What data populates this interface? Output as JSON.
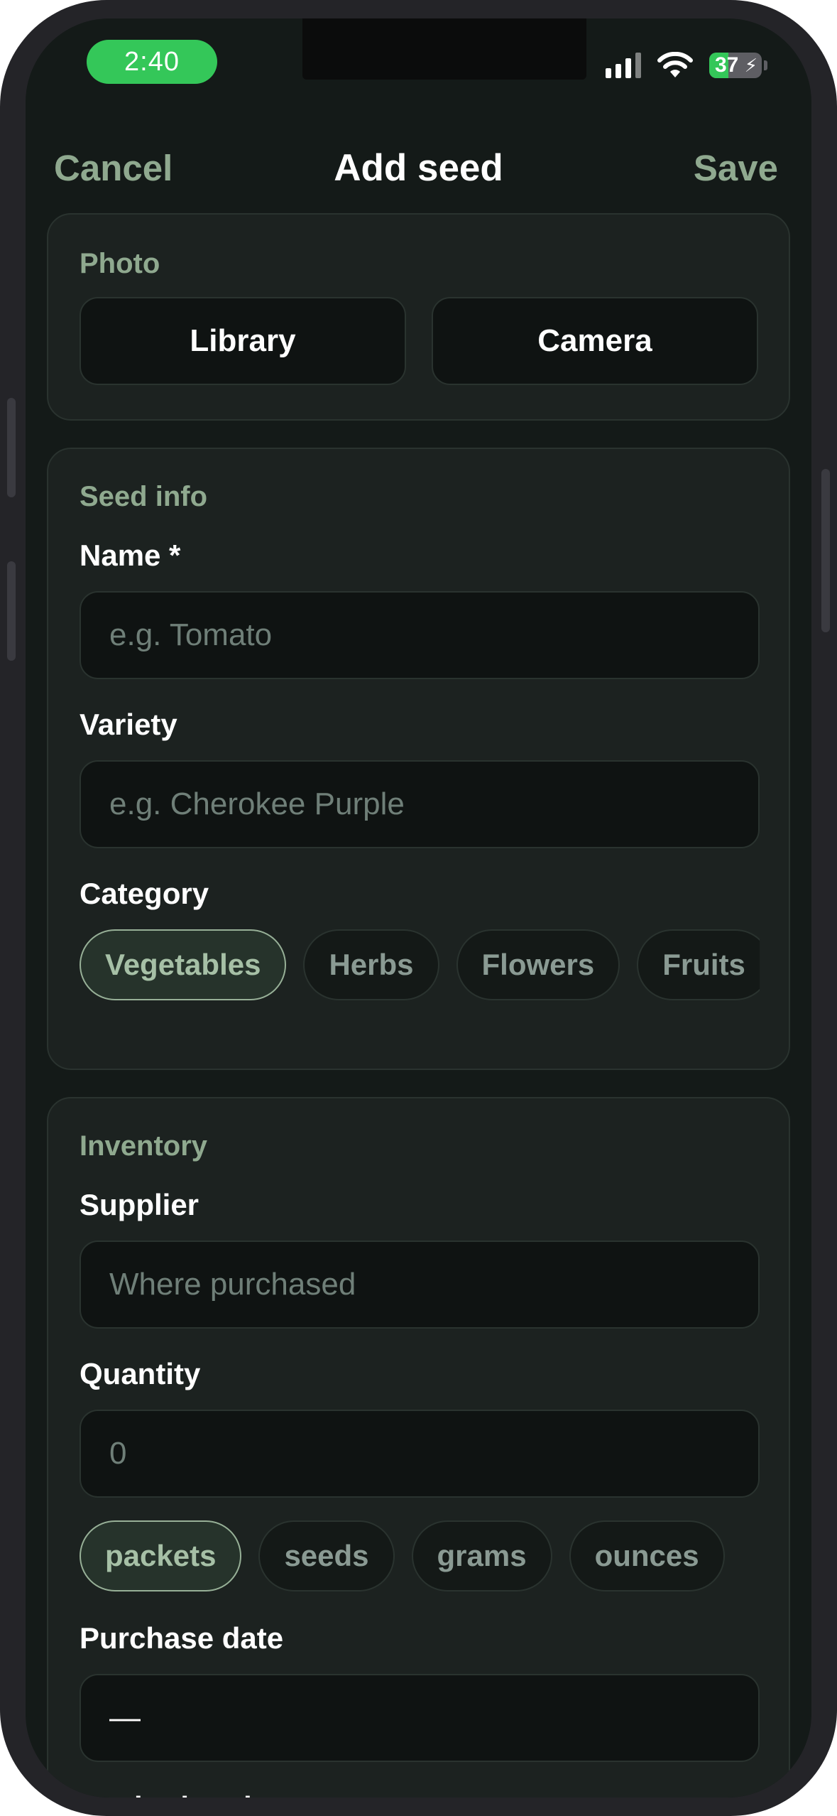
{
  "status_bar": {
    "time": "2:40",
    "battery_percent": "37",
    "battery_level": 0.37,
    "icons": [
      "cellular-signal-icon",
      "wifi-icon",
      "battery-charging-icon"
    ]
  },
  "nav": {
    "cancel_label": "Cancel",
    "title": "Add seed",
    "save_label": "Save"
  },
  "photo": {
    "section_label": "Photo",
    "library_label": "Library",
    "camera_label": "Camera"
  },
  "seed_info": {
    "section_label": "Seed info",
    "name_label": "Name *",
    "name_placeholder": "e.g. Tomato",
    "name_value": "",
    "variety_label": "Variety",
    "variety_placeholder": "e.g. Cherokee Purple",
    "variety_value": "",
    "category_label": "Category",
    "categories": [
      "Vegetables",
      "Herbs",
      "Flowers",
      "Fruits"
    ],
    "selected_category": "Vegetables"
  },
  "inventory": {
    "section_label": "Inventory",
    "supplier_label": "Supplier",
    "supplier_placeholder": "Where purchased",
    "supplier_value": "",
    "quantity_label": "Quantity",
    "quantity_placeholder": "0",
    "quantity_value": "",
    "units": [
      "packets",
      "seeds",
      "grams",
      "ounces"
    ],
    "selected_unit": "packets",
    "purchase_date_label": "Purchase date",
    "purchase_date_value": "—",
    "expiration_date_label": "Expiration date"
  },
  "colors": {
    "accent": "#8fa98f",
    "background": "#141a18",
    "card": "#1c2220",
    "field": "#0f1312",
    "status_green": "#34c759"
  }
}
